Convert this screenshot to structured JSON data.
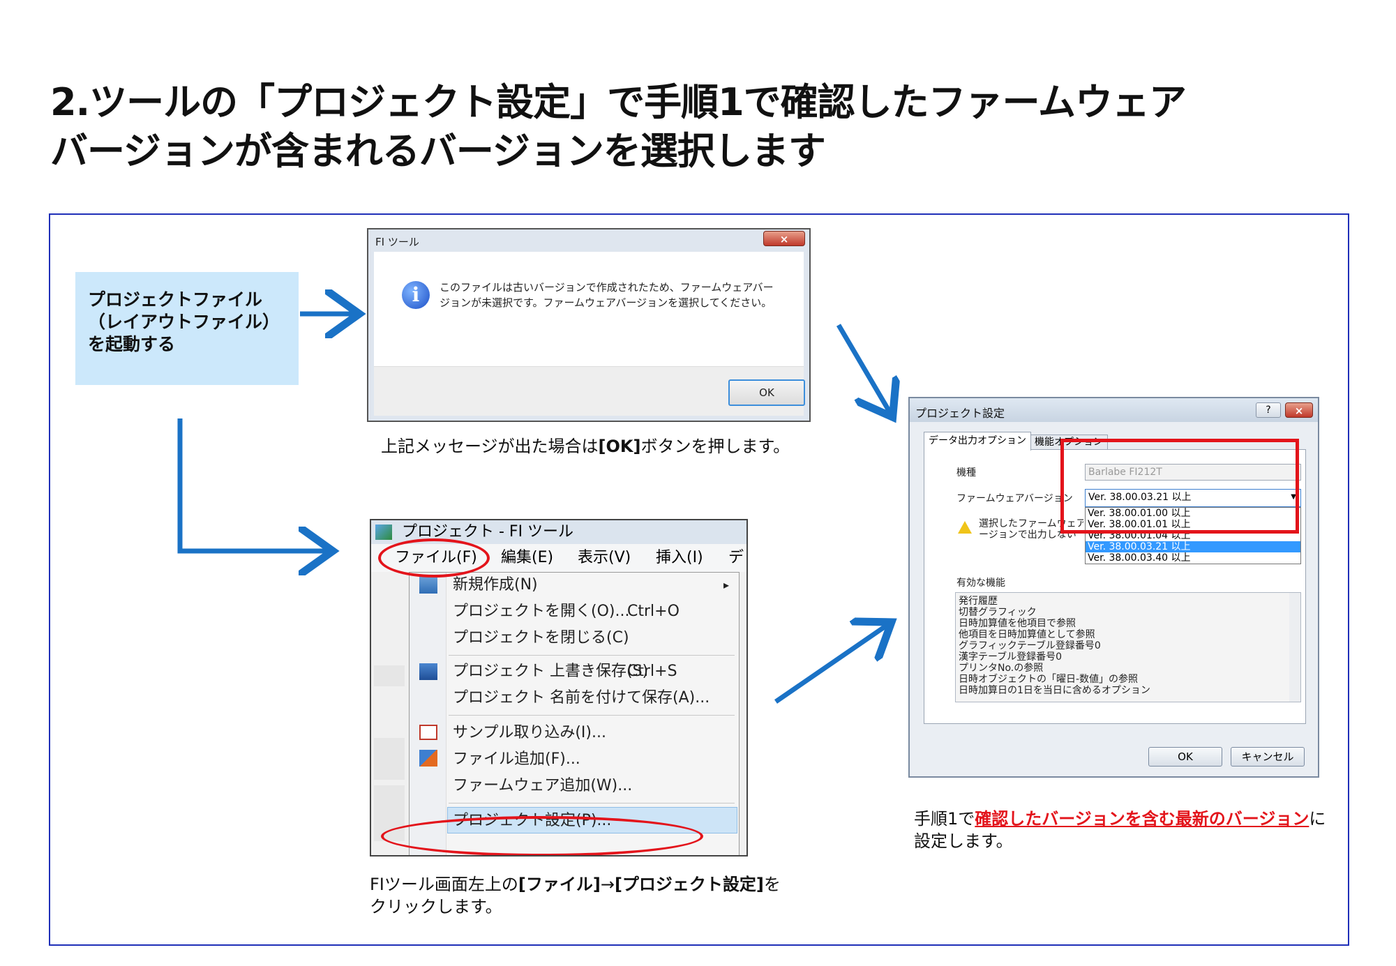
{
  "title": {
    "line1": "2.ツールの「プロジェクト設定」で手順1で確認したファームウェア",
    "line2": "バージョンが含まれるバージョンを選択します"
  },
  "start_box": {
    "line1": "プロジェクトファイル",
    "line2": "（レイアウトファイル）",
    "line3": "を起動する"
  },
  "dialog1": {
    "window_title": "FI ツール",
    "close_glyph": "×",
    "message": "このファイルは古いバージョンで作成されたため、ファームウェアバージョンが未選択です。ファームウェアバージョンを選択してください。",
    "ok_label": "OK"
  },
  "caption1": {
    "pre": "上記メッセージが出た場合は",
    "bold": "[OK]",
    "post": "ボタンを押します。"
  },
  "menu_window": {
    "window_title": "プロジェクト - FI ツール",
    "menubar": [
      "ファイル(F)",
      "編集(E)",
      "表示(V)",
      "挿入(I)",
      "デ"
    ],
    "items": [
      {
        "label": "新規作成(N)",
        "shortcut": "",
        "submenu": "▸"
      },
      {
        "label": "プロジェクトを開く(O)...",
        "shortcut": "Ctrl+O"
      },
      {
        "label": "プロジェクトを閉じる(C)",
        "shortcut": ""
      },
      {
        "label": "プロジェクト 上書き保存(S)",
        "shortcut": "Ctrl+S"
      },
      {
        "label": "プロジェクト 名前を付けて保存(A)...",
        "shortcut": ""
      },
      {
        "label": "サンプル取り込み(I)...",
        "shortcut": ""
      },
      {
        "label": "ファイル追加(F)...",
        "shortcut": ""
      },
      {
        "label": "ファームウェア追加(W)...",
        "shortcut": ""
      },
      {
        "label": "プロジェクト設定(P)...",
        "shortcut": ""
      }
    ]
  },
  "caption2": {
    "pre": "FIツール画面左上の",
    "bold1": "[ファイル]",
    "mid": "→",
    "bold2": "[プロジェクト設定]",
    "post": "をクリックします。"
  },
  "project_settings": {
    "window_title": "プロジェクト設定",
    "help_glyph": "?",
    "close_glyph": "×",
    "tabs": [
      "データ出力オプション",
      "機能オプション"
    ],
    "model_label": "機種",
    "model_value": "Barlabe FI212T",
    "firmware_label": "ファームウェアバージョン",
    "firmware_selected": "Ver. 38.00.03.21 以上",
    "firmware_options": [
      "Ver. 38.00.01.00 以上",
      "Ver. 38.00.01.01 以上",
      "Ver. 38.00.01.04 以上",
      "Ver. 38.00.03.21 以上",
      "Ver. 38.00.03.40 以上"
    ],
    "highlighted_option_index": 3,
    "warning_text_line1": "選択したファームウェア",
    "warning_text_line2": "ージョンで出力しない",
    "features_label": "有効な機能",
    "features": [
      "発行履歴",
      "切替グラフィック",
      "日時加算値を他項目で参照",
      "他項目を日時加算値として参照",
      "グラフィックテーブル登録番号0",
      "漢字テーブル登録番号0",
      "プリンタNo.の参照",
      "日時オブジェクトの「曜日-数値」の参照",
      "日時加算日の1日を当日に含めるオプション"
    ],
    "ok_label": "OK",
    "cancel_label": "キャンセル"
  },
  "caption3": {
    "pre": "手順1で",
    "red": "確認したバージョンを含む最新のバージョン",
    "post": "に設定します。"
  },
  "colors": {
    "arrow": "#1a72c6",
    "highlight_red": "#e3141b",
    "start_box_bg": "#cce8fb",
    "frame_border": "#1f2fb8",
    "selection_blue": "#3399ff"
  }
}
